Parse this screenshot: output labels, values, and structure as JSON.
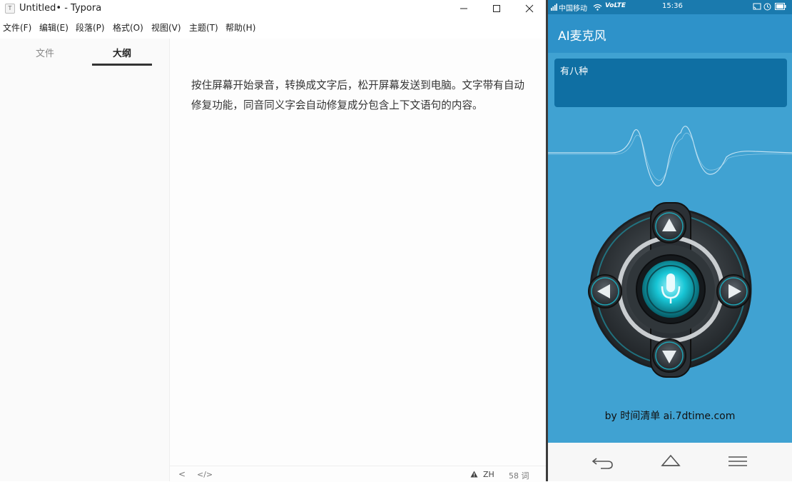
{
  "window": {
    "app_icon": "T",
    "title": "Untitled• - Typora"
  },
  "menu": [
    {
      "label": "文件(F)",
      "name": "menu-file"
    },
    {
      "label": "编辑(E)",
      "name": "menu-edit"
    },
    {
      "label": "段落(P)",
      "name": "menu-paragraph"
    },
    {
      "label": "格式(O)",
      "name": "menu-format"
    },
    {
      "label": "视图(V)",
      "name": "menu-view"
    },
    {
      "label": "主题(T)",
      "name": "menu-theme"
    },
    {
      "label": "帮助(H)",
      "name": "menu-help"
    }
  ],
  "sidebar": {
    "tabs": [
      {
        "label": "文件",
        "active": false
      },
      {
        "label": "大纲",
        "active": true
      }
    ]
  },
  "editor": {
    "paragraph": "按住屏幕开始录音，转换成文字后，松开屏幕发送到电脑。文字带有自动修复功能，同音同义字会自动修复成分包含上下文语句的内容。"
  },
  "statusbar": {
    "prev_glyph": "<",
    "source_glyph": "</>",
    "warning_icon": "warning-icon",
    "language": "ZH",
    "word_count": "58 词"
  },
  "phone": {
    "status": {
      "carrier": "中国移动",
      "network": "VoLTE",
      "time": "15:36"
    },
    "app_title": "AI麦克风",
    "recognized_text": "有八种",
    "credit": "by 时间清单 ai.7dtime.com",
    "colors": {
      "screen_bg": "#40a2d2",
      "appbar": "#2e92c9",
      "textbox": "#0f6fa3",
      "mic_glow": "#18c6d6"
    }
  }
}
